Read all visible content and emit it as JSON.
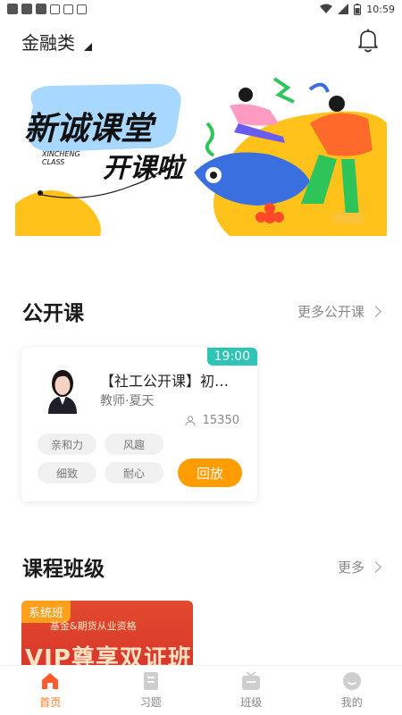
{
  "status_bar": {
    "time": "10:59"
  },
  "header": {
    "category": "金融类"
  },
  "banner": {
    "title_line1": "新诚课堂",
    "title_line2": "开课啦",
    "subtitle_line1": "XINCHENG",
    "subtitle_line2": "CLASS"
  },
  "open_courses": {
    "section_title": "公开课",
    "more_label": "更多公开课",
    "card": {
      "time": "19:00",
      "title": "【社工公开课】初级社会工作",
      "teacher": "教师·夏天",
      "viewers": "15350",
      "tags": [
        "亲和力",
        "风趣",
        "细致",
        "耐心"
      ],
      "action_label": "回放"
    }
  },
  "classes": {
    "section_title": "课程班级",
    "more_label": "更多",
    "card": {
      "badge": "系统班",
      "subtitle": "基金&期货从业资格",
      "title": "VIP尊享双证班"
    }
  },
  "bottom_nav": {
    "items": [
      {
        "label": "首页",
        "icon": "home-icon",
        "active": true
      },
      {
        "label": "习题",
        "icon": "exercise-icon",
        "active": false
      },
      {
        "label": "班级",
        "icon": "class-icon",
        "active": false
      },
      {
        "label": "我的",
        "icon": "profile-icon",
        "active": false
      }
    ]
  },
  "colors": {
    "accent": "#ff9c00",
    "nav_active": "#ff7a1a",
    "time_tag": "#2ec4b6"
  }
}
